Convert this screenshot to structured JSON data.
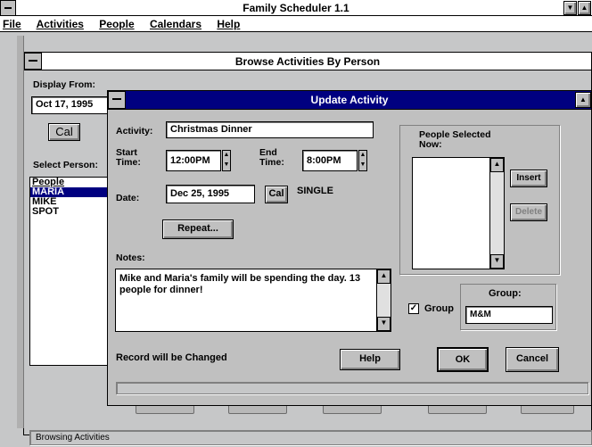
{
  "app": {
    "title": "Family Scheduler 1.1",
    "menu": [
      "File",
      "Activities",
      "People",
      "Calendars",
      "Help"
    ],
    "status": "Browsing Activities"
  },
  "browse": {
    "title": "Browse Activities By Person",
    "display_from_label": "Display From:",
    "display_from_value": "Oct 17, 1995",
    "cal_label": "Cal",
    "select_person_label": "Select Person:",
    "people_header": "People",
    "people": [
      "MARIA",
      "MIKE",
      "SPOT"
    ]
  },
  "dialog": {
    "title": "Update Activity",
    "activity_label": "Activity:",
    "activity_value": "Christmas Dinner",
    "start_label": "Start Time:",
    "start_value": "12:00PM",
    "end_label": "End Time:",
    "end_value": "8:00PM",
    "date_label": "Date:",
    "date_value": "Dec 25, 1995",
    "cal_label": "Cal",
    "recurrence": "SINGLE",
    "repeat_label": "Repeat...",
    "notes_label": "Notes:",
    "notes_value": "Mike and Maria's family will be spending the day. 13 people for dinner!",
    "people_selected_label": "People Selected Now:",
    "insert_label": "Insert",
    "delete_label": "Delete",
    "group_checkbox_label": "Group",
    "group_checked": true,
    "group_field_label": "Group:",
    "group_value": "M&M",
    "status_message": "Record will be Changed",
    "help_label": "Help",
    "ok_label": "OK",
    "cancel_label": "Cancel"
  },
  "colors": {
    "active_title": "#000080",
    "face": "#c0c0c0",
    "desktop": "#c6c7c8"
  }
}
